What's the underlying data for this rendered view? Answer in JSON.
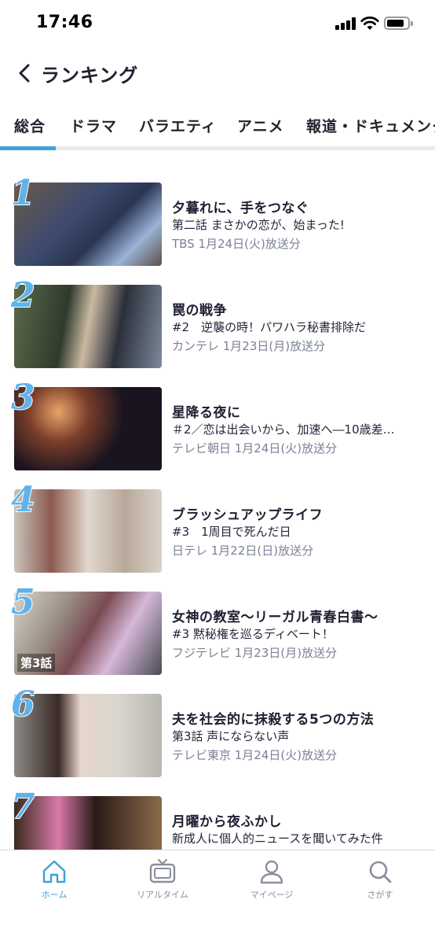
{
  "status_bar": {
    "time": "17:46"
  },
  "header": {
    "title": "ランキング"
  },
  "tabs": [
    {
      "label": "総合"
    },
    {
      "label": "ドラマ"
    },
    {
      "label": "バラエティ"
    },
    {
      "label": "アニメ"
    },
    {
      "label": "報道・ドキュメンタリー"
    }
  ],
  "active_tab": "総合",
  "rankings": [
    {
      "rank": "1",
      "title": "夕暮れに、手をつなぐ",
      "subtitle": "第二話 まさかの恋が、始まった!",
      "meta": "TBS 1月24日(火)放送分"
    },
    {
      "rank": "2",
      "title": "罠の戦争",
      "subtitle": "#2　逆襲の時！パワハラ秘書排除だ",
      "meta": "カンテレ 1月23日(月)放送分"
    },
    {
      "rank": "3",
      "title": "星降る夜に",
      "subtitle": "＃2／恋は出会いから、加速へ―10歳差…",
      "meta": "テレビ朝日 1月24日(火)放送分"
    },
    {
      "rank": "4",
      "title": "ブラッシュアップライフ",
      "subtitle": "#3　1周目で死んだ日",
      "meta": "日テレ 1月22日(日)放送分"
    },
    {
      "rank": "5",
      "title": "女神の教室～リーガル青春白書～",
      "subtitle": "#3 黙秘権を巡るディベート！",
      "meta": "フジテレビ 1月23日(月)放送分",
      "badge": "第3話"
    },
    {
      "rank": "6",
      "title": "夫を社会的に抹殺する5つの方法",
      "subtitle": "第3話 声にならない声",
      "meta": "テレビ東京 1月24日(火)放送分"
    },
    {
      "rank": "7",
      "title": "月曜から夜ふかし",
      "subtitle": "新成人に個人的ニュースを聞いてみた件",
      "meta": ""
    }
  ],
  "bottom_nav": [
    {
      "label": "ホーム",
      "icon": "home-icon",
      "active": true
    },
    {
      "label": "リアルタイム",
      "icon": "tv-icon",
      "active": false
    },
    {
      "label": "マイページ",
      "icon": "person-icon",
      "active": false
    },
    {
      "label": "さがす",
      "icon": "search-icon",
      "active": false
    }
  ],
  "colors": {
    "accent": "#3fa2dc",
    "rank_number": "#5fb2ea",
    "meta_text": "#7b8196"
  }
}
